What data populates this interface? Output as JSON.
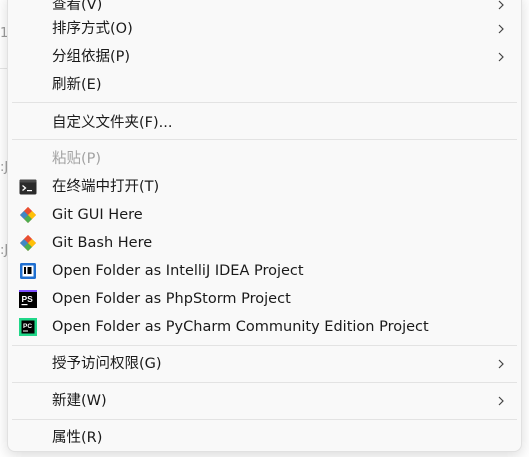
{
  "menu": {
    "items": [
      {
        "label": "查看(V)",
        "has_submenu": true
      },
      {
        "label": "排序方式(O)",
        "has_submenu": true
      },
      {
        "label": "分组依据(P)",
        "has_submenu": true
      },
      {
        "label": "刷新(E)"
      },
      {
        "label": "自定义文件夹(F)..."
      },
      {
        "label": "粘贴(P)",
        "disabled": true
      },
      {
        "label": "在终端中打开(T)",
        "icon": "terminal-icon"
      },
      {
        "label": "Git GUI Here",
        "icon": "git-icon"
      },
      {
        "label": "Git Bash Here",
        "icon": "git-icon"
      },
      {
        "label": "Open Folder as IntelliJ IDEA Project",
        "icon": "intellij-idea-icon"
      },
      {
        "label": "Open Folder as PhpStorm Project",
        "icon": "phpstorm-icon"
      },
      {
        "label": "Open Folder as PyCharm Community Edition Project",
        "icon": "pycharm-icon"
      },
      {
        "label": "授予访问权限(G)",
        "has_submenu": true
      },
      {
        "label": "新建(W)",
        "has_submenu": true
      },
      {
        "label": "属性(R)"
      }
    ]
  },
  "icons": {
    "phpstorm": {
      "text": "PS"
    },
    "pycharm": {
      "text": "PC"
    }
  },
  "colors": {
    "menu_background": "#f9f9f9",
    "separator": "#e3e3e3",
    "text": "#1a1a1a",
    "disabled_text": "#a3a3a3",
    "git_red": "#f05133",
    "git_green": "#4caf50"
  }
}
